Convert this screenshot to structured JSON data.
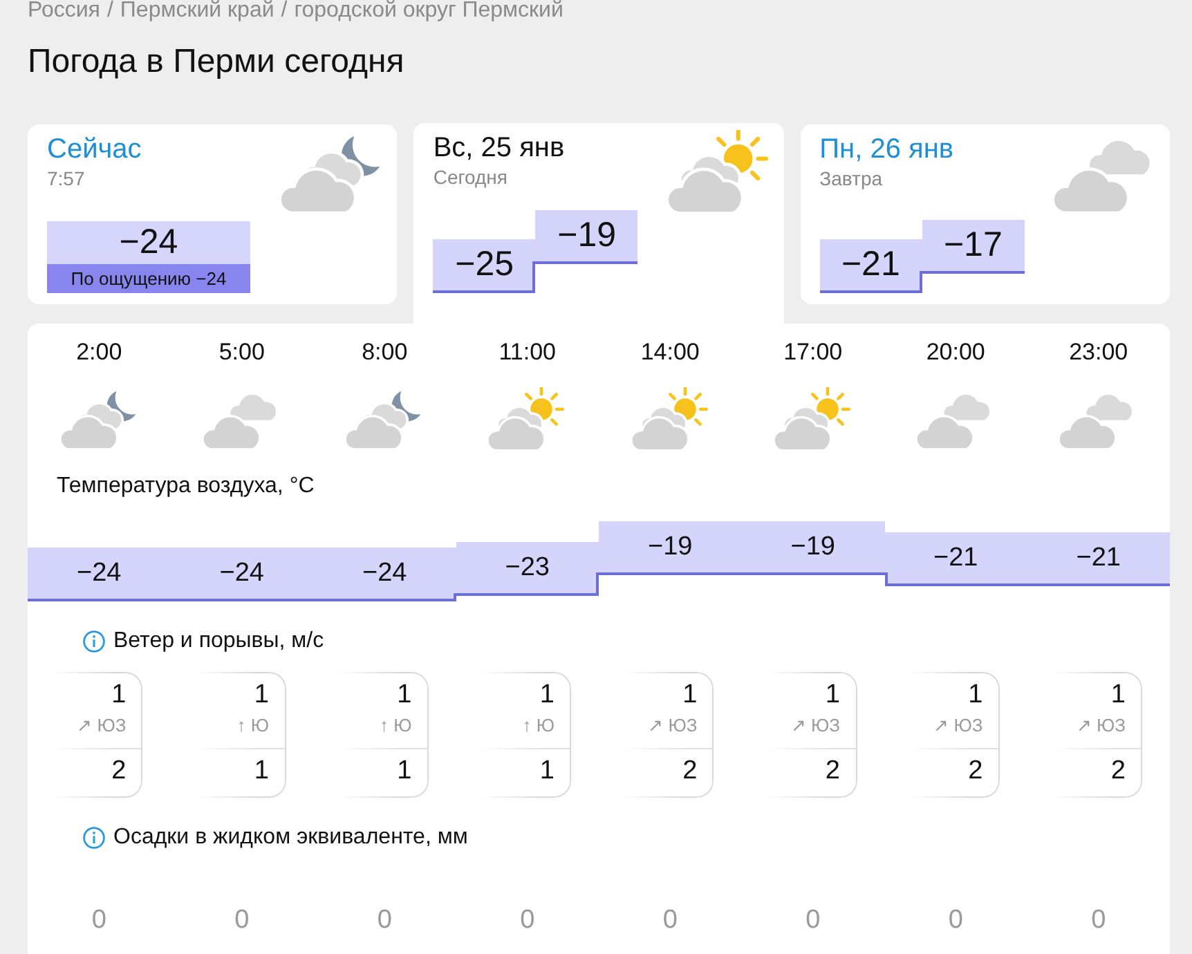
{
  "breadcrumb": {
    "items": [
      "Россия",
      "Пермский край",
      "городской округ Пермский"
    ],
    "separator": "/"
  },
  "title": "Погода в Перми сегодня",
  "cards": [
    {
      "kind": "current",
      "heading": "Сейчас",
      "subheading": "7:57",
      "icon": {
        "kind": "cloudy_night"
      },
      "temperature": "−24",
      "feels_like": "По ощущению −24",
      "selected": false
    },
    {
      "kind": "day",
      "heading": "Вс, 25 янв",
      "subheading": "Сегодня",
      "icon": {
        "kind": "partly_sunny"
      },
      "low": "−25",
      "high": "−19",
      "selected": true
    },
    {
      "kind": "day",
      "heading": "Пн, 26 янв",
      "subheading": "Завтра",
      "icon": {
        "kind": "overcast"
      },
      "low": "−21",
      "high": "−17",
      "selected": false
    }
  ],
  "hourly": {
    "hours": [
      {
        "time": "2:00",
        "icon": {
          "kind": "cloudy_night"
        },
        "temperature": "−24",
        "wind_speed": "1",
        "wind_direction": "↗ ЮЗ",
        "gusts": "2",
        "precipitation": "0"
      },
      {
        "time": "5:00",
        "icon": {
          "kind": "overcast"
        },
        "temperature": "−24",
        "wind_speed": "1",
        "wind_direction": "↑ Ю",
        "gusts": "1",
        "precipitation": "0"
      },
      {
        "time": "8:00",
        "icon": {
          "kind": "cloudy_night"
        },
        "temperature": "−24",
        "wind_speed": "1",
        "wind_direction": "↑ Ю",
        "gusts": "1",
        "precipitation": "0"
      },
      {
        "time": "11:00",
        "icon": {
          "kind": "partly_sunny"
        },
        "temperature": "−23",
        "wind_speed": "1",
        "wind_direction": "↑ Ю",
        "gusts": "1",
        "precipitation": "0"
      },
      {
        "time": "14:00",
        "icon": {
          "kind": "partly_sunny"
        },
        "temperature": "−19",
        "wind_speed": "1",
        "wind_direction": "↗ ЮЗ",
        "gusts": "2",
        "precipitation": "0"
      },
      {
        "time": "17:00",
        "icon": {
          "kind": "partly_sunny"
        },
        "temperature": "−19",
        "wind_speed": "1",
        "wind_direction": "↗ ЮЗ",
        "gusts": "2",
        "precipitation": "0"
      },
      {
        "time": "20:00",
        "icon": {
          "kind": "overcast"
        },
        "temperature": "−21",
        "wind_speed": "1",
        "wind_direction": "↗ ЮЗ",
        "gusts": "2",
        "precipitation": "0"
      },
      {
        "time": "23:00",
        "icon": {
          "kind": "overcast"
        },
        "temperature": "−21",
        "wind_speed": "1",
        "wind_direction": "↗ ЮЗ",
        "gusts": "2",
        "precipitation": "0"
      }
    ],
    "temperature_title": "Температура воздуха, °C",
    "wind_title": "Ветер и порывы, м/с",
    "precipitation_title": "Осадки в жидком эквиваленте, мм"
  }
}
